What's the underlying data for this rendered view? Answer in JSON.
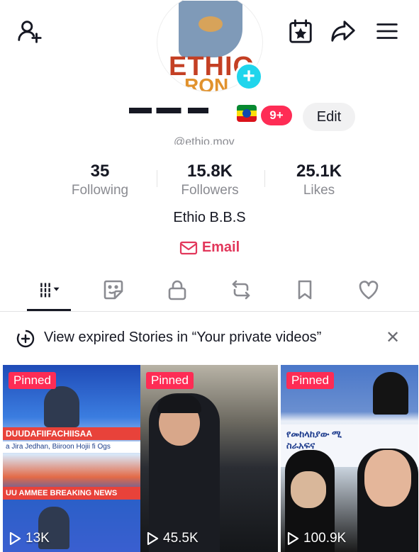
{
  "topbar": {
    "icons": [
      "add-friend-icon",
      "calendar-star-icon",
      "share-icon",
      "menu-icon"
    ]
  },
  "profile": {
    "avatar_text_line1": "ETHIO",
    "avatar_text_line2": "RON",
    "handle": "@ethio.mov",
    "notification_count": "9+",
    "edit_label": "Edit"
  },
  "stats": [
    {
      "value": "35",
      "label": "Following"
    },
    {
      "value": "15.8K",
      "label": "Followers"
    },
    {
      "value": "25.1K",
      "label": "Likes"
    }
  ],
  "bio": "Ethio B.B.S",
  "email_label": "Email",
  "tabs": [
    "videos-tab",
    "favorites-tab",
    "private-tab",
    "reposts-tab",
    "saved-tab",
    "liked-tab"
  ],
  "banner": {
    "text": "View expired Stories in “Your private videos”"
  },
  "videos": [
    {
      "pinned_label": "Pinned",
      "views": "13K",
      "caption_lines": [
        "DUUDAFIIFACHIISAA",
        "a Jira Jedhan,   Biiroon Hojii fi Ogs",
        "UU AMMEE   BREAKING NEWS"
      ]
    },
    {
      "pinned_label": "Pinned",
      "views": "45.5K"
    },
    {
      "pinned_label": "Pinned",
      "views": "100.9K",
      "caption_lines": [
        "የመከላከያው ሚ",
        "ስራአፍና"
      ]
    }
  ],
  "colors": {
    "accent": "#fe2c55",
    "email": "#e2375b",
    "badge": "#20d5ec"
  }
}
